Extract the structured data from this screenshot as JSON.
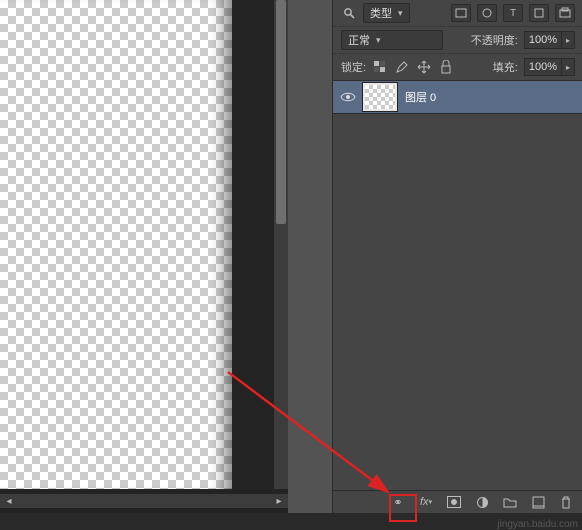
{
  "filter": {
    "label": "类型",
    "search_icon": "search"
  },
  "blend": {
    "mode": "正常",
    "opacity_label": "不透明度:",
    "opacity_value": "100%"
  },
  "lock": {
    "label": "锁定:",
    "fill_label": "填充:",
    "fill_value": "100%"
  },
  "layers": [
    {
      "name": "图层 0",
      "visible": true
    }
  ],
  "footer_icons": [
    "link",
    "fx",
    "mask",
    "adjust",
    "group",
    "new",
    "trash"
  ],
  "watermark": "jingyan.baidu.com"
}
